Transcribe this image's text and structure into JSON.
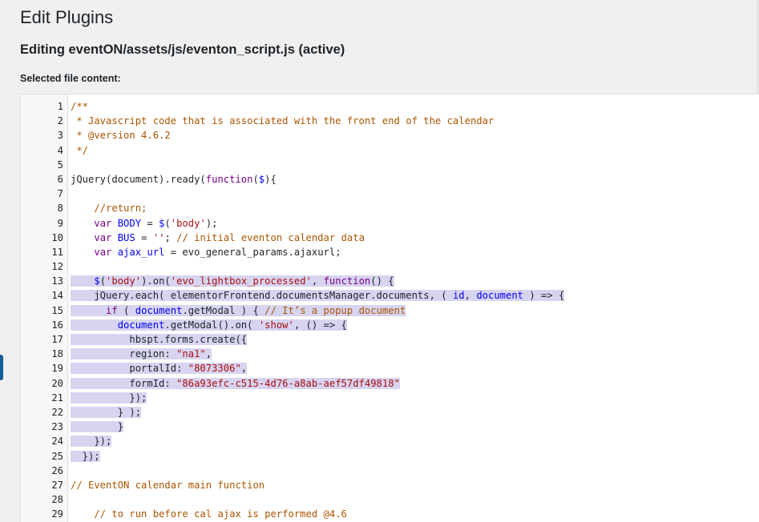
{
  "page": {
    "title": "Edit Plugins",
    "file_heading": "Editing eventON/assets/js/eventon_script.js (active)",
    "content_label": "Selected file content:"
  },
  "colors": {
    "comment": "#aa5500",
    "keyword": "#770088",
    "variable": "#0000ff",
    "string": "#aa1111",
    "selection": "#d7d4f0"
  },
  "editor": {
    "lines": [
      {
        "n": "1",
        "sel": false,
        "tokens": [
          {
            "t": "/**",
            "c": "comment"
          }
        ]
      },
      {
        "n": "2",
        "sel": false,
        "tokens": [
          {
            "t": " * Javascript code that is associated with the front end of the calendar",
            "c": "comment"
          }
        ]
      },
      {
        "n": "3",
        "sel": false,
        "tokens": [
          {
            "t": " * @version 4.6.2",
            "c": "comment"
          }
        ]
      },
      {
        "n": "4",
        "sel": false,
        "tokens": [
          {
            "t": " */",
            "c": "comment"
          }
        ]
      },
      {
        "n": "5",
        "sel": false,
        "tokens": []
      },
      {
        "n": "6",
        "sel": false,
        "tokens": [
          {
            "t": "jQuery(document).ready(",
            "c": "plain"
          },
          {
            "t": "function",
            "c": "keyword"
          },
          {
            "t": "(",
            "c": "plain"
          },
          {
            "t": "$",
            "c": "var"
          },
          {
            "t": "){",
            "c": "plain"
          }
        ]
      },
      {
        "n": "7",
        "sel": false,
        "tokens": []
      },
      {
        "n": "8",
        "sel": false,
        "tokens": [
          {
            "t": "    ",
            "c": "plain"
          },
          {
            "t": "//return;",
            "c": "comment"
          }
        ]
      },
      {
        "n": "9",
        "sel": false,
        "tokens": [
          {
            "t": "    ",
            "c": "plain"
          },
          {
            "t": "var",
            "c": "keyword"
          },
          {
            "t": " ",
            "c": "plain"
          },
          {
            "t": "BODY",
            "c": "var"
          },
          {
            "t": " = ",
            "c": "plain"
          },
          {
            "t": "$",
            "c": "var"
          },
          {
            "t": "(",
            "c": "plain"
          },
          {
            "t": "'body'",
            "c": "str"
          },
          {
            "t": ");",
            "c": "plain"
          }
        ]
      },
      {
        "n": "10",
        "sel": false,
        "tokens": [
          {
            "t": "    ",
            "c": "plain"
          },
          {
            "t": "var",
            "c": "keyword"
          },
          {
            "t": " ",
            "c": "plain"
          },
          {
            "t": "BUS",
            "c": "var"
          },
          {
            "t": " = ",
            "c": "plain"
          },
          {
            "t": "''",
            "c": "str"
          },
          {
            "t": "; ",
            "c": "plain"
          },
          {
            "t": "// initial eventon calendar data",
            "c": "comment"
          }
        ]
      },
      {
        "n": "11",
        "sel": false,
        "tokens": [
          {
            "t": "    ",
            "c": "plain"
          },
          {
            "t": "var",
            "c": "keyword"
          },
          {
            "t": " ",
            "c": "plain"
          },
          {
            "t": "ajax_url",
            "c": "var"
          },
          {
            "t": " = evo_general_params.ajaxurl;",
            "c": "plain"
          }
        ]
      },
      {
        "n": "12",
        "sel": false,
        "tokens": []
      },
      {
        "n": "13",
        "sel": true,
        "tokens": [
          {
            "t": "    ",
            "c": "plain"
          },
          {
            "t": "$",
            "c": "var"
          },
          {
            "t": "(",
            "c": "plain"
          },
          {
            "t": "'body'",
            "c": "str"
          },
          {
            "t": ").on(",
            "c": "plain"
          },
          {
            "t": "'evo_lightbox_processed'",
            "c": "str"
          },
          {
            "t": ", ",
            "c": "plain"
          },
          {
            "t": "function",
            "c": "keyword"
          },
          {
            "t": "() {",
            "c": "plain"
          }
        ]
      },
      {
        "n": "14",
        "sel": true,
        "tokens": [
          {
            "t": "    jQuery.each( elementorFrontend.documentsManager.documents, ( ",
            "c": "plain"
          },
          {
            "t": "id",
            "c": "var"
          },
          {
            "t": ", ",
            "c": "plain"
          },
          {
            "t": "document",
            "c": "var"
          },
          {
            "t": " ) => {",
            "c": "plain"
          }
        ]
      },
      {
        "n": "15",
        "sel": true,
        "tokens": [
          {
            "t": "      ",
            "c": "plain"
          },
          {
            "t": "if",
            "c": "keyword"
          },
          {
            "t": " ( ",
            "c": "plain"
          },
          {
            "t": "document",
            "c": "var"
          },
          {
            "t": ".getModal ) { ",
            "c": "plain"
          },
          {
            "t": "// It’s a popup document",
            "c": "comment"
          }
        ]
      },
      {
        "n": "16",
        "sel": true,
        "tokens": [
          {
            "t": "        ",
            "c": "plain"
          },
          {
            "t": "document",
            "c": "var"
          },
          {
            "t": ".getModal().on( ",
            "c": "plain"
          },
          {
            "t": "'show'",
            "c": "str"
          },
          {
            "t": ", () => {",
            "c": "plain"
          }
        ]
      },
      {
        "n": "17",
        "sel": true,
        "tokens": [
          {
            "t": "          hbspt.forms.create({",
            "c": "plain"
          }
        ]
      },
      {
        "n": "18",
        "sel": true,
        "tokens": [
          {
            "t": "          region: ",
            "c": "plain"
          },
          {
            "t": "\"na1\"",
            "c": "str"
          },
          {
            "t": ",",
            "c": "plain"
          }
        ]
      },
      {
        "n": "19",
        "sel": true,
        "tokens": [
          {
            "t": "          portalId: ",
            "c": "plain"
          },
          {
            "t": "\"8073306\"",
            "c": "str"
          },
          {
            "t": ",",
            "c": "plain"
          }
        ]
      },
      {
        "n": "20",
        "sel": true,
        "tokens": [
          {
            "t": "          formId: ",
            "c": "plain"
          },
          {
            "t": "\"86a93efc-c515-4d76-a8ab-aef57df49818\"",
            "c": "str"
          }
        ]
      },
      {
        "n": "21",
        "sel": true,
        "tokens": [
          {
            "t": "          });",
            "c": "plain"
          }
        ]
      },
      {
        "n": "22",
        "sel": true,
        "tokens": [
          {
            "t": "        } );",
            "c": "plain"
          }
        ]
      },
      {
        "n": "23",
        "sel": true,
        "tokens": [
          {
            "t": "        }",
            "c": "plain"
          }
        ]
      },
      {
        "n": "24",
        "sel": true,
        "tokens": [
          {
            "t": "    });",
            "c": "plain"
          }
        ]
      },
      {
        "n": "25",
        "sel": true,
        "tokens": [
          {
            "t": "  });",
            "c": "plain"
          }
        ]
      },
      {
        "n": "26",
        "sel": false,
        "tokens": []
      },
      {
        "n": "27",
        "sel": false,
        "tokens": [
          {
            "t": "// EventON calendar main function",
            "c": "comment"
          }
        ]
      },
      {
        "n": "28",
        "sel": false,
        "tokens": []
      },
      {
        "n": "29",
        "sel": false,
        "tokens": [
          {
            "t": "    ",
            "c": "plain"
          },
          {
            "t": "// to run before cal ajax is performed @4.6",
            "c": "comment"
          }
        ]
      }
    ]
  }
}
